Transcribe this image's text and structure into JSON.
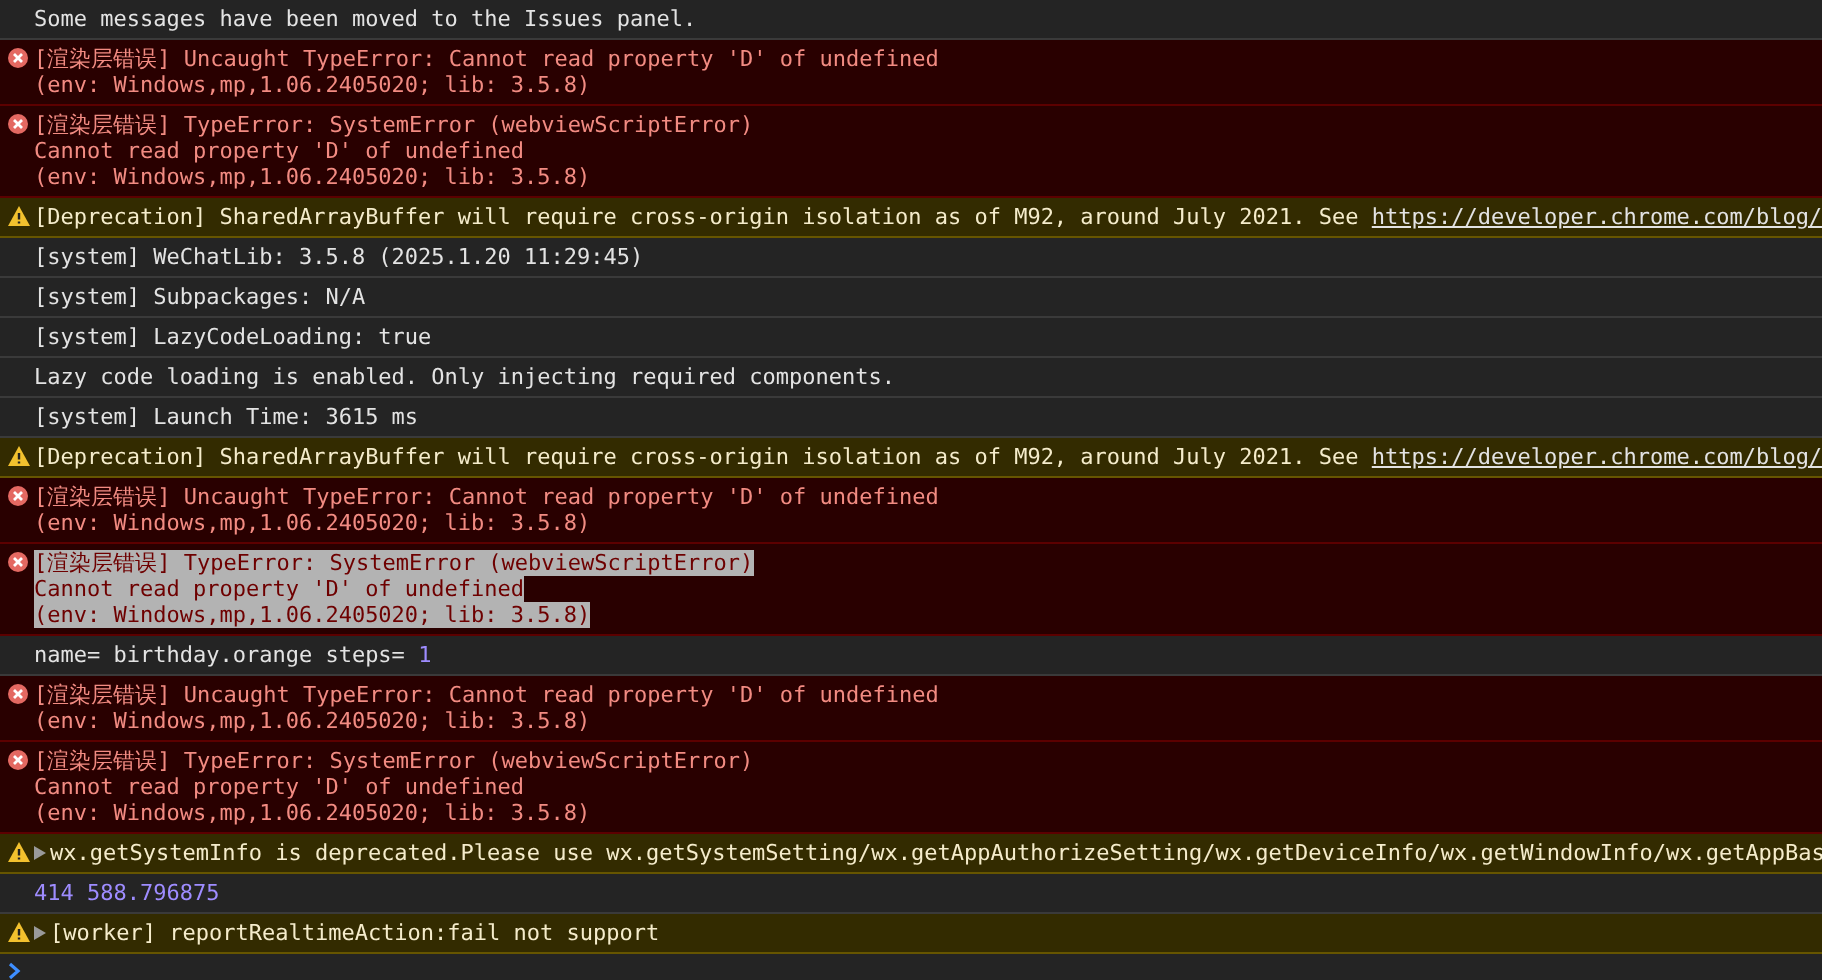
{
  "messages": [
    {
      "kind": "info",
      "lines": [
        "Some messages have been moved to the Issues panel."
      ],
      "selected": false
    },
    {
      "kind": "error",
      "lines": [
        "[渲染层错误] Uncaught TypeError: Cannot read property 'D' of undefined",
        "(env: Windows,mp,1.06.2405020; lib: 3.5.8)"
      ],
      "selected": false
    },
    {
      "kind": "error",
      "lines": [
        "[渲染层错误] TypeError: SystemError (webviewScriptError)",
        "Cannot read property 'D' of undefined",
        "(env: Windows,mp,1.06.2405020; lib: 3.5.8)"
      ],
      "selected": false
    },
    {
      "kind": "warning",
      "lines": [
        "[Deprecation] SharedArrayBuffer will require cross-origin isolation as of M92, around July 2021. See "
      ],
      "link": "https://developer.chrome.com/blog/",
      "selected": false
    },
    {
      "kind": "log",
      "lines": [
        "[system] WeChatLib: 3.5.8 (2025.1.20 11:29:45)"
      ],
      "selected": false
    },
    {
      "kind": "log",
      "lines": [
        "[system] Subpackages: N/A"
      ],
      "selected": false
    },
    {
      "kind": "log",
      "lines": [
        "[system] LazyCodeLoading: true"
      ],
      "selected": false
    },
    {
      "kind": "log",
      "lines": [
        "Lazy code loading is enabled. Only injecting required components."
      ],
      "selected": false
    },
    {
      "kind": "log",
      "lines": [
        "[system] Launch Time: 3615 ms"
      ],
      "selected": false
    },
    {
      "kind": "warning",
      "lines": [
        "[Deprecation] SharedArrayBuffer will require cross-origin isolation as of M92, around July 2021. See "
      ],
      "link": "https://developer.chrome.com/blog/",
      "selected": false
    },
    {
      "kind": "error",
      "lines": [
        "[渲染层错误] Uncaught TypeError: Cannot read property 'D' of undefined",
        "(env: Windows,mp,1.06.2405020; lib: 3.5.8)"
      ],
      "selected": false
    },
    {
      "kind": "error",
      "lines": [
        "[渲染层错误] TypeError: SystemError (webviewScriptError)",
        "Cannot read property 'D' of undefined",
        "(env: Windows,mp,1.06.2405020; lib: 3.5.8)"
      ],
      "selected": true
    },
    {
      "kind": "log",
      "lines": [
        "name= birthday.orange steps= "
      ],
      "number": "1",
      "selected": false
    },
    {
      "kind": "error",
      "lines": [
        "[渲染层错误] Uncaught TypeError: Cannot read property 'D' of undefined",
        "(env: Windows,mp,1.06.2405020; lib: 3.5.8)"
      ],
      "selected": false
    },
    {
      "kind": "error",
      "lines": [
        "[渲染层错误] TypeError: SystemError (webviewScriptError)",
        "Cannot read property 'D' of undefined",
        "(env: Windows,mp,1.06.2405020; lib: 3.5.8)"
      ],
      "selected": false
    },
    {
      "kind": "warning",
      "lines": [
        "wx.getSystemInfo is deprecated.Please use wx.getSystemSetting/wx.getAppAuthorizeSetting/wx.getDeviceInfo/wx.getWindowInfo/wx.getAppBas"
      ],
      "expanded": false,
      "selected": false
    },
    {
      "kind": "number",
      "lines": [
        "414 588.796875"
      ],
      "selected": false
    },
    {
      "kind": "warning",
      "lines": [
        "[worker] reportRealtimeAction:fail not support"
      ],
      "expanded": false,
      "selected": false
    }
  ]
}
